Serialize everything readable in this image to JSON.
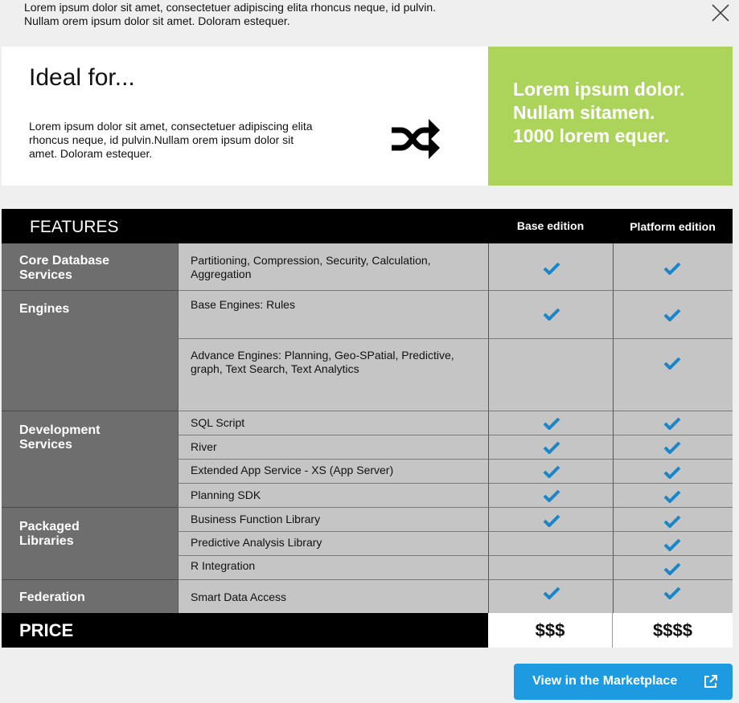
{
  "top_text": {
    "line1": "Lorem ipsum dolor sit amet, consectetuer adipiscing elita rhoncus neque, id pulvin.",
    "line2": "Nullam orem ipsum dolor sit amet. Doloram estequer."
  },
  "close_icon": "close-icon",
  "hero": {
    "title": "Ideal for...",
    "description": "Lorem ipsum dolor sit amet, consectetuer adipiscing elita rhoncus neque, id pulvin.Nullam orem ipsum dolor sit amet. Doloram estequer.",
    "icon": "shuffle-icon",
    "green_lines": [
      "Lorem ipsum dolor.",
      "Nullam sitamen.",
      "1000 lorem equer."
    ],
    "green_color": "#acd35a"
  },
  "table": {
    "features_label": "FEATURES",
    "columns": [
      "Base edition",
      "Platform edition"
    ],
    "categories": [
      {
        "name": "Core Database Services"
      },
      {
        "name": "Engines"
      },
      {
        "name": "Development Services"
      },
      {
        "name": "Packaged Libraries"
      },
      {
        "name": "Federation"
      }
    ],
    "rows": [
      {
        "feature": "Partitioning, Compression, Security, Calculation, Aggregation",
        "base": true,
        "platform": true
      },
      {
        "feature": "Base Engines: Rules",
        "base": true,
        "platform": true
      },
      {
        "feature": "Advance Engines: Planning, Geo-SPatial, Predictive, graph, Text Search, Text Analytics",
        "base": false,
        "platform": true
      },
      {
        "feature": "SQL Script",
        "base": true,
        "platform": true
      },
      {
        "feature": "River",
        "base": true,
        "platform": true
      },
      {
        "feature": "Extended App Service - XS (App Server)",
        "base": true,
        "platform": true
      },
      {
        "feature": "Planning SDK",
        "base": true,
        "platform": true
      },
      {
        "feature": "Business Function Library",
        "base": true,
        "platform": true
      },
      {
        "feature": "Predictive Analysis Library",
        "base": false,
        "platform": true
      },
      {
        "feature": "R Integration",
        "base": false,
        "platform": true
      },
      {
        "feature": "Smart Data Access",
        "base": true,
        "platform": true
      }
    ],
    "price_label": "PRICE",
    "prices": [
      "$$$",
      "$$$$"
    ],
    "check_color": "#1a86c8"
  },
  "marketplace_button": {
    "label": "View in the Marketplace",
    "icon": "external-link-icon",
    "color": "#1e9be0"
  }
}
